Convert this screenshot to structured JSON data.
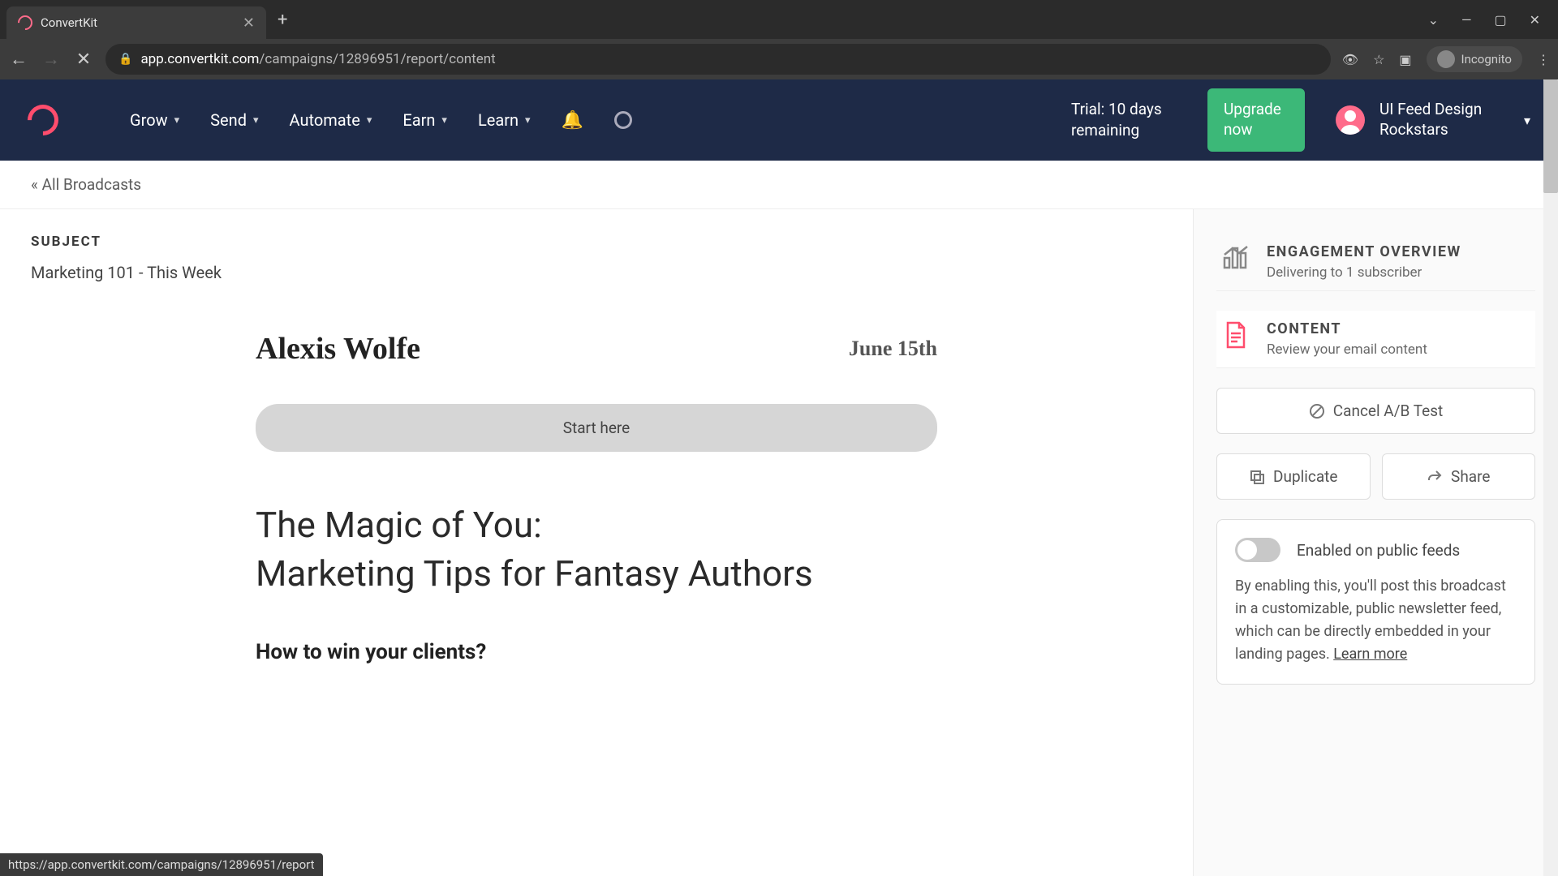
{
  "browser": {
    "tab_title": "ConvertKit",
    "url_domain": "app.convertkit.com",
    "url_path": "/campaigns/12896951/report/content",
    "incognito_label": "Incognito",
    "status_url": "https://app.convertkit.com/campaigns/12896951/report"
  },
  "nav": {
    "items": [
      {
        "label": "Grow"
      },
      {
        "label": "Send"
      },
      {
        "label": "Automate"
      },
      {
        "label": "Earn"
      },
      {
        "label": "Learn"
      }
    ],
    "trial_text": "Trial: 10 days remaining",
    "upgrade_label": "Upgrade now",
    "account_name": "UI Feed Design Rockstars"
  },
  "breadcrumb": {
    "back_label": "« All Broadcasts"
  },
  "content": {
    "subject_label": "SUBJECT",
    "subject_text": "Marketing 101 - This Week",
    "author": "Alexis Wolfe",
    "date": "June 15th",
    "start_button": "Start here",
    "headline1": "The Magic of You:",
    "headline2": "Marketing Tips for Fantasy Authors",
    "subhead": "How to win your clients?"
  },
  "sidebar": {
    "engagement": {
      "title": "ENGAGEMENT OVERVIEW",
      "subtitle": "Delivering to 1 subscriber"
    },
    "content": {
      "title": "CONTENT",
      "subtitle": "Review your email content"
    },
    "actions": {
      "cancel_ab": "Cancel A/B Test",
      "duplicate": "Duplicate",
      "share": "Share"
    },
    "feed": {
      "toggle_label": "Enabled on public feeds",
      "description": "By enabling this, you'll post this broadcast in a customizable, public newsletter feed, which can be directly embedded in your landing pages. ",
      "learn_more": "Learn more"
    }
  }
}
